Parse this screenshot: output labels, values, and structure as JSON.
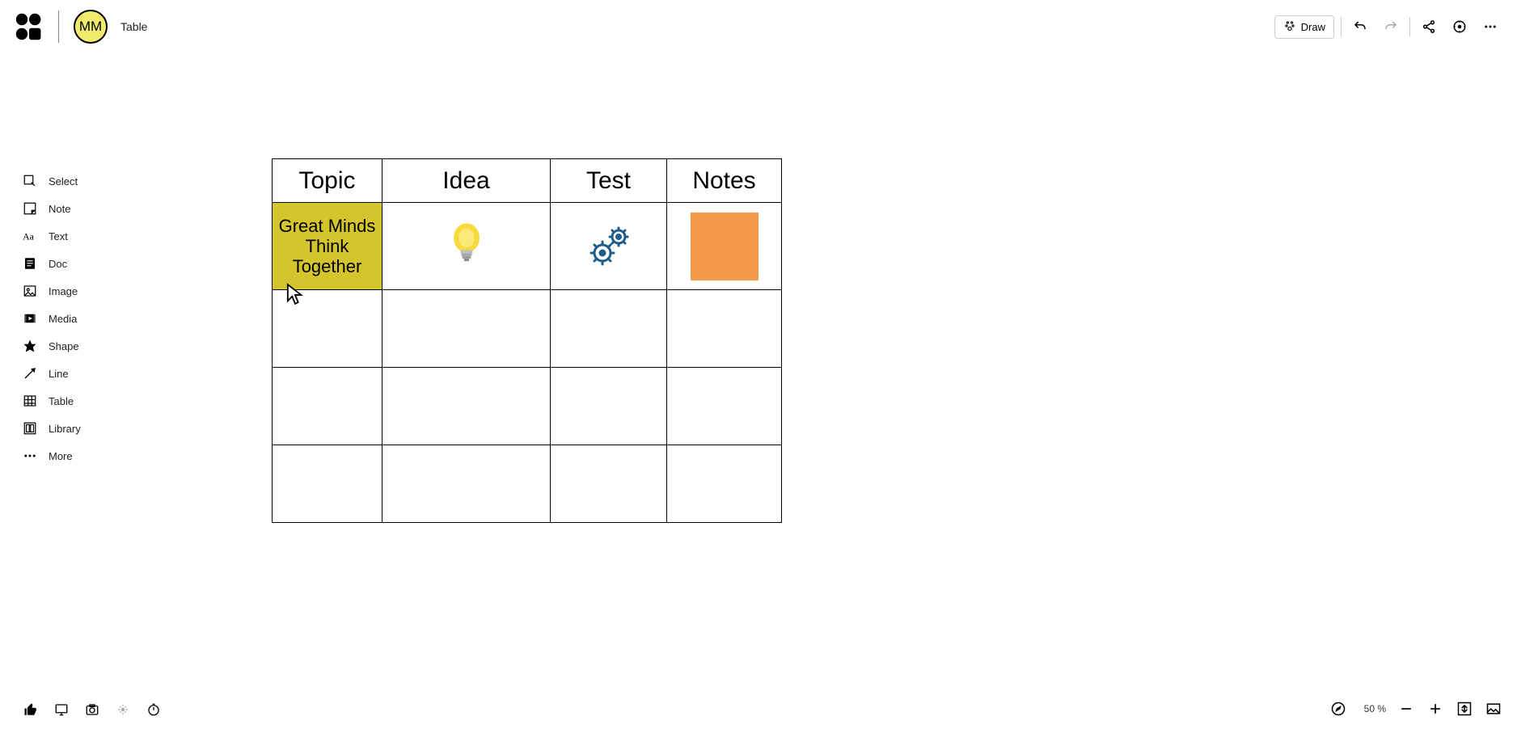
{
  "header": {
    "avatar_initials": "MM",
    "document_title": "Table",
    "draw_label": "Draw"
  },
  "sidebar": {
    "items": [
      {
        "label": "Select"
      },
      {
        "label": "Note"
      },
      {
        "label": "Text"
      },
      {
        "label": "Doc"
      },
      {
        "label": "Image"
      },
      {
        "label": "Media"
      },
      {
        "label": "Shape"
      },
      {
        "label": "Line"
      },
      {
        "label": "Table"
      },
      {
        "label": "Library"
      },
      {
        "label": "More"
      }
    ]
  },
  "zoom": {
    "level_label": "50 %"
  },
  "board": {
    "headers": [
      "Topic",
      "Idea",
      "Test",
      "Notes"
    ],
    "rows": [
      {
        "topic_text": "Great Minds Think Together",
        "idea_icon": "lightbulb",
        "test_icon": "gears",
        "notes_note_color": "#f2994a"
      },
      {},
      {},
      {}
    ],
    "topic_cell_color": "#d4c52d"
  }
}
